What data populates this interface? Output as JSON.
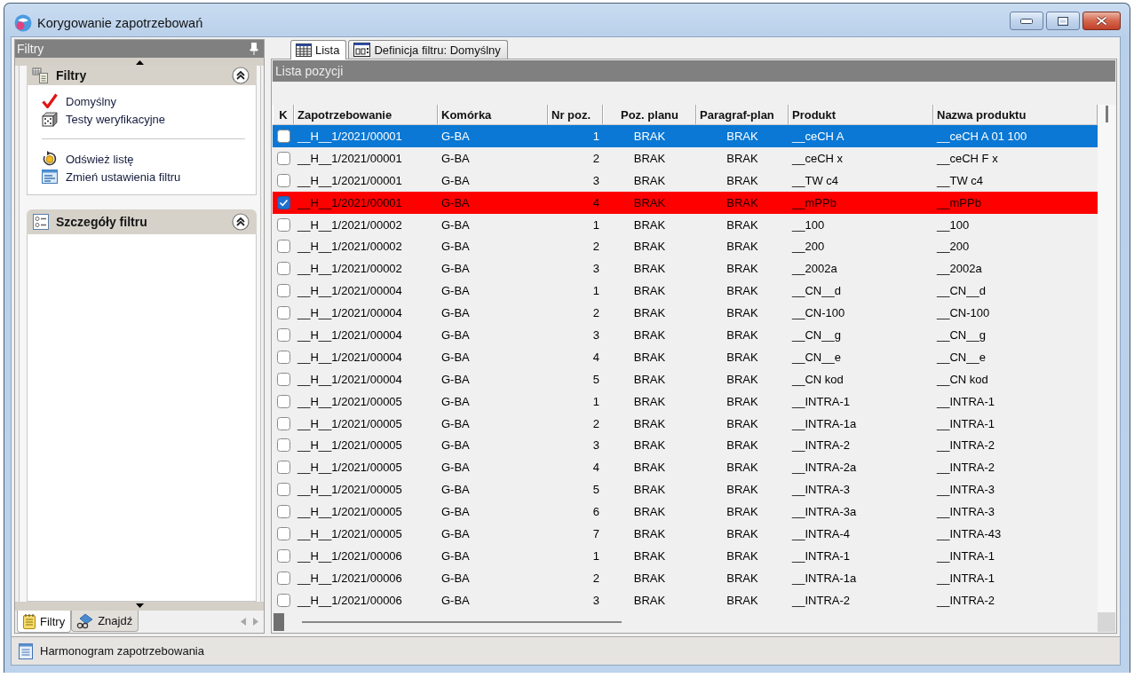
{
  "window": {
    "title": "Korygowanie zapotrzebowań"
  },
  "filter_panel": {
    "title": "Filtry",
    "sections": [
      {
        "kind": "filters",
        "title": "Filtry",
        "expanded": true,
        "filters": [
          {
            "label": "Domyślny",
            "active": true
          },
          {
            "label": "Testy weryfikacyjne",
            "active": false
          }
        ],
        "actions": [
          {
            "kind": "refresh",
            "label": "Odśwież listę"
          },
          {
            "kind": "settings",
            "label": "Zmień ustawienia filtru"
          }
        ]
      },
      {
        "kind": "details",
        "title": "Szczegóły filtru",
        "expanded": true
      }
    ],
    "tabs": [
      {
        "kind": "filters",
        "label": "Filtry",
        "selected": true
      },
      {
        "kind": "search",
        "label": "Znajdź",
        "selected": false
      }
    ]
  },
  "tabs": [
    {
      "kind": "list",
      "label": "Lista",
      "selected": true
    },
    {
      "kind": "definition",
      "label": "Definicja filtru: Domyślny",
      "selected": false
    }
  ],
  "list": {
    "title": "Lista pozycji",
    "check_column": "K",
    "columns": [
      "Zapotrzebowanie",
      "Komórka",
      "Nr poz.",
      "Poz. planu",
      "Paragraf-plan",
      "Produkt",
      "Nazwa produktu"
    ],
    "rows": [
      {
        "selected": true,
        "checked": false,
        "highlighted": false,
        "cells": [
          "__H__1/2021/00001",
          "G-BA",
          "1",
          "BRAK",
          "BRAK",
          "__ceCH A",
          "__ceCH A 01 100"
        ]
      },
      {
        "selected": false,
        "checked": false,
        "highlighted": false,
        "cells": [
          "__H__1/2021/00001",
          "G-BA",
          "2",
          "BRAK",
          "BRAK",
          "__ceCH x",
          "__ceCH F x"
        ]
      },
      {
        "selected": false,
        "checked": false,
        "highlighted": false,
        "cells": [
          "__H__1/2021/00001",
          "G-BA",
          "3",
          "BRAK",
          "BRAK",
          "__TW c4",
          "__TW c4"
        ]
      },
      {
        "selected": false,
        "checked": true,
        "highlighted": true,
        "cells": [
          "__H__1/2021/00001",
          "G-BA",
          "4",
          "BRAK",
          "BRAK",
          "__mPPb",
          "__mPPb"
        ]
      },
      {
        "selected": false,
        "checked": false,
        "highlighted": false,
        "cells": [
          "__H__1/2021/00002",
          "G-BA",
          "1",
          "BRAK",
          "BRAK",
          "__100",
          "__100"
        ]
      },
      {
        "selected": false,
        "checked": false,
        "highlighted": false,
        "cells": [
          "__H__1/2021/00002",
          "G-BA",
          "2",
          "BRAK",
          "BRAK",
          "__200",
          "__200"
        ]
      },
      {
        "selected": false,
        "checked": false,
        "highlighted": false,
        "cells": [
          "__H__1/2021/00002",
          "G-BA",
          "3",
          "BRAK",
          "BRAK",
          "__2002a",
          "__2002a"
        ]
      },
      {
        "selected": false,
        "checked": false,
        "highlighted": false,
        "cells": [
          "__H__1/2021/00004",
          "G-BA",
          "1",
          "BRAK",
          "BRAK",
          "__CN__d",
          "__CN__d"
        ]
      },
      {
        "selected": false,
        "checked": false,
        "highlighted": false,
        "cells": [
          "__H__1/2021/00004",
          "G-BA",
          "2",
          "BRAK",
          "BRAK",
          "__CN-100",
          "__CN-100"
        ]
      },
      {
        "selected": false,
        "checked": false,
        "highlighted": false,
        "cells": [
          "__H__1/2021/00004",
          "G-BA",
          "3",
          "BRAK",
          "BRAK",
          "__CN__g",
          "__CN__g"
        ]
      },
      {
        "selected": false,
        "checked": false,
        "highlighted": false,
        "cells": [
          "__H__1/2021/00004",
          "G-BA",
          "4",
          "BRAK",
          "BRAK",
          "__CN__e",
          "__CN__e"
        ]
      },
      {
        "selected": false,
        "checked": false,
        "highlighted": false,
        "cells": [
          "__H__1/2021/00004",
          "G-BA",
          "5",
          "BRAK",
          "BRAK",
          "__CN kod",
          "__CN kod"
        ]
      },
      {
        "selected": false,
        "checked": false,
        "highlighted": false,
        "cells": [
          "__H__1/2021/00005",
          "G-BA",
          "1",
          "BRAK",
          "BRAK",
          "__INTRA-1",
          "__INTRA-1"
        ]
      },
      {
        "selected": false,
        "checked": false,
        "highlighted": false,
        "cells": [
          "__H__1/2021/00005",
          "G-BA",
          "2",
          "BRAK",
          "BRAK",
          "__INTRA-1a",
          "__INTRA-1"
        ]
      },
      {
        "selected": false,
        "checked": false,
        "highlighted": false,
        "cells": [
          "__H__1/2021/00005",
          "G-BA",
          "3",
          "BRAK",
          "BRAK",
          "__INTRA-2",
          "__INTRA-2"
        ]
      },
      {
        "selected": false,
        "checked": false,
        "highlighted": false,
        "cells": [
          "__H__1/2021/00005",
          "G-BA",
          "4",
          "BRAK",
          "BRAK",
          "__INTRA-2a",
          "__INTRA-2"
        ]
      },
      {
        "selected": false,
        "checked": false,
        "highlighted": false,
        "cells": [
          "__H__1/2021/00005",
          "G-BA",
          "5",
          "BRAK",
          "BRAK",
          "__INTRA-3",
          "__INTRA-3"
        ]
      },
      {
        "selected": false,
        "checked": false,
        "highlighted": false,
        "cells": [
          "__H__1/2021/00005",
          "G-BA",
          "6",
          "BRAK",
          "BRAK",
          "__INTRA-3a",
          "__INTRA-3"
        ]
      },
      {
        "selected": false,
        "checked": false,
        "highlighted": false,
        "cells": [
          "__H__1/2021/00005",
          "G-BA",
          "7",
          "BRAK",
          "BRAK",
          "__INTRA-4",
          "__INTRA-43"
        ]
      },
      {
        "selected": false,
        "checked": false,
        "highlighted": false,
        "cells": [
          "__H__1/2021/00006",
          "G-BA",
          "1",
          "BRAK",
          "BRAK",
          "__INTRA-1",
          "__INTRA-1"
        ]
      },
      {
        "selected": false,
        "checked": false,
        "highlighted": false,
        "cells": [
          "__H__1/2021/00006",
          "G-BA",
          "2",
          "BRAK",
          "BRAK",
          "__INTRA-1a",
          "__INTRA-1"
        ]
      },
      {
        "selected": false,
        "checked": false,
        "highlighted": false,
        "cells": [
          "__H__1/2021/00006",
          "G-BA",
          "3",
          "BRAK",
          "BRAK",
          "__INTRA-2",
          "__INTRA-2"
        ]
      }
    ]
  },
  "status_bar": {
    "item": "Harmonogram zapotrzebowania"
  }
}
